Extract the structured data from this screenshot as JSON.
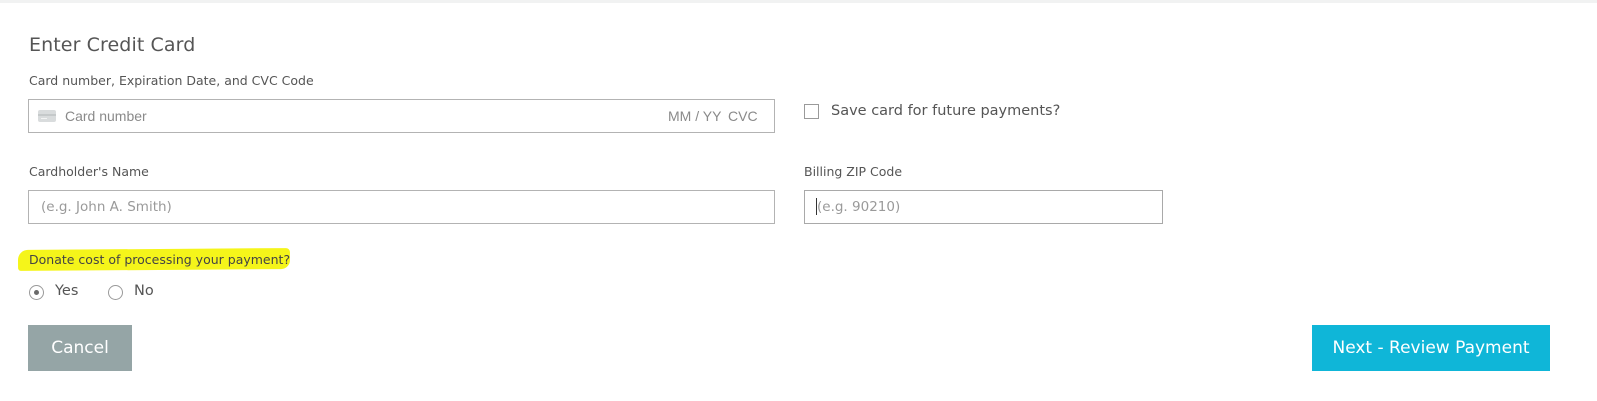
{
  "form": {
    "title": "Enter Credit Card",
    "card_label": "Card number, Expiration Date, and CVC Code",
    "card_number_placeholder": "Card number",
    "card_exp_placeholder": "MM / YY",
    "card_cvc_placeholder": "CVC",
    "card_icon": "credit-card-icon",
    "save_card_label": "Save card for future payments?",
    "save_card_checked": false,
    "cardholder_label": "Cardholder's Name",
    "cardholder_placeholder": "(e.g. John A. Smith)",
    "cardholder_value": "",
    "zip_label": "Billing ZIP Code",
    "zip_placeholder": "(e.g. 90210)",
    "zip_value": ""
  },
  "donate": {
    "question": "Donate cost of processing your payment?",
    "highlight_color": "#f5f51a",
    "options": [
      {
        "label": "Yes",
        "selected": true
      },
      {
        "label": "No",
        "selected": false
      }
    ]
  },
  "actions": {
    "cancel_label": "Cancel",
    "cancel_color": "#95a5a6",
    "next_label": "Next - Review Payment",
    "next_color": "#0fb6d8"
  }
}
